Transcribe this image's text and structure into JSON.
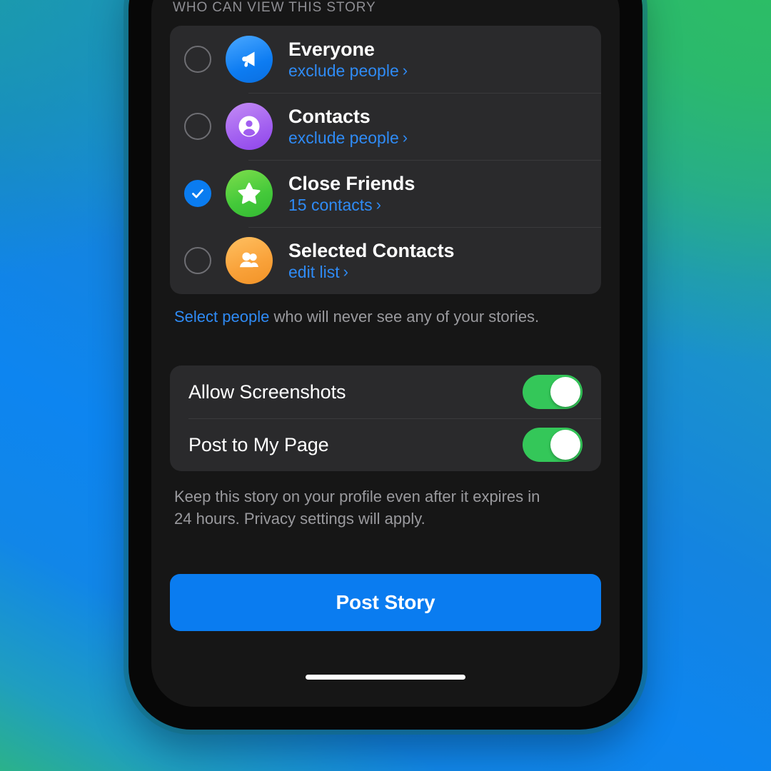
{
  "screen": {
    "section_header": "WHO CAN VIEW THIS STORY",
    "audience": {
      "options": [
        {
          "id": "everyone",
          "title": "Everyone",
          "subtitle": "exclude people",
          "chevron": "›",
          "selected": false,
          "icon": "megaphone-icon",
          "icon_color": "#0d7cf2"
        },
        {
          "id": "contacts",
          "title": "Contacts",
          "subtitle": "exclude people",
          "chevron": "›",
          "selected": false,
          "icon": "person-circle-icon",
          "icon_color": "#a15ef0"
        },
        {
          "id": "close-friends",
          "title": "Close Friends",
          "subtitle": "15 contacts",
          "chevron": "›",
          "selected": true,
          "icon": "star-icon",
          "icon_color": "#44c93a"
        },
        {
          "id": "selected-contacts",
          "title": "Selected Contacts",
          "subtitle": "edit list",
          "chevron": "›",
          "selected": false,
          "icon": "people-group-icon",
          "icon_color": "#f9a23a"
        }
      ],
      "footnote_link": "Select people",
      "footnote_rest": " who will never see any of your stories."
    },
    "toggles": [
      {
        "id": "allow-screenshots",
        "label": "Allow Screenshots",
        "on": true
      },
      {
        "id": "post-to-my-page",
        "label": "Post to My Page",
        "on": true
      }
    ],
    "explanation": "Keep this story on your profile even after it expires in 24 hours. Privacy settings will apply.",
    "primary_button": "Post Story"
  },
  "colors": {
    "accent_blue": "#0a7cf0",
    "link_blue": "#2f8bf5",
    "toggle_green": "#34c759",
    "card_bg": "#2a2a2c",
    "screen_bg": "#161616",
    "secondary_text": "#9a9a9e"
  }
}
